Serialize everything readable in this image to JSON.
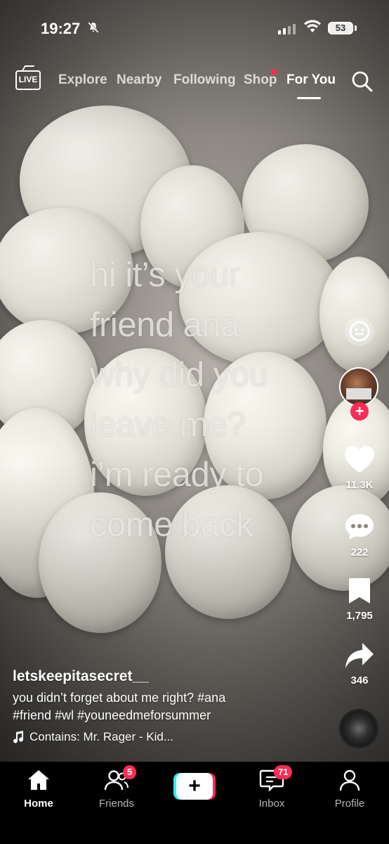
{
  "status_bar": {
    "time": "19:27",
    "battery": "53"
  },
  "top_nav": {
    "live_label": "LIVE",
    "tabs": [
      {
        "label": "Explore"
      },
      {
        "label": "Nearby"
      },
      {
        "label": "Following"
      },
      {
        "label": "Shop"
      },
      {
        "label": "For You"
      }
    ],
    "active_tab": "For You"
  },
  "video": {
    "overlay_text": "hi it’s your\nfriend ana\nwhy did you\nleave me?\ni’m ready to\ncome back"
  },
  "actions": {
    "likes": "11.3K",
    "comments": "222",
    "saves": "1,795",
    "shares": "346"
  },
  "post": {
    "username": "letskeepitasecret__",
    "description_line1": "you didn’t forget about me right? #ana",
    "description_line2": "#friend #wl #youneedmeforsummer",
    "music": "Contains: Mr. Rager - Kid..."
  },
  "tab_bar": {
    "home": "Home",
    "friends": "Friends",
    "friends_badge": "5",
    "inbox": "Inbox",
    "inbox_badge": "71",
    "profile": "Profile"
  },
  "colors": {
    "accent": "#fe2c55",
    "cyan": "#25f4ee"
  }
}
